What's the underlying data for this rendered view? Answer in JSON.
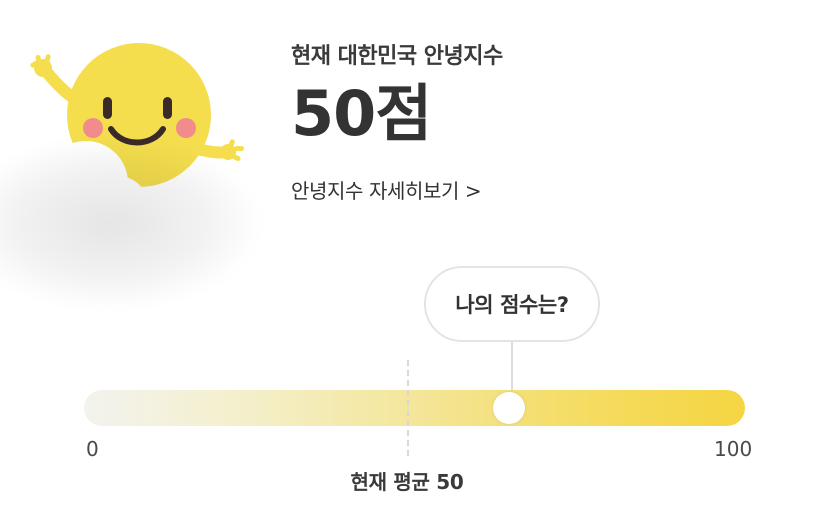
{
  "header": {
    "subtitle": "현재 대한민국 안녕지수",
    "score": "50점",
    "detail_link": "안녕지수 자세히보기 >"
  },
  "gauge": {
    "bubble_label": "나의 점수는?",
    "min_label": "0",
    "max_label": "100",
    "my_score": 65,
    "average": 50,
    "average_label": "현재 평균 50"
  },
  "icons": {
    "mascot": "smiling-sun-mascot-icon",
    "cloud": "cloud-icon"
  },
  "colors": {
    "sun": "#F4DE4E",
    "cheek": "#F28B8B",
    "gauge_end": "#F5D542",
    "text": "#333333"
  }
}
